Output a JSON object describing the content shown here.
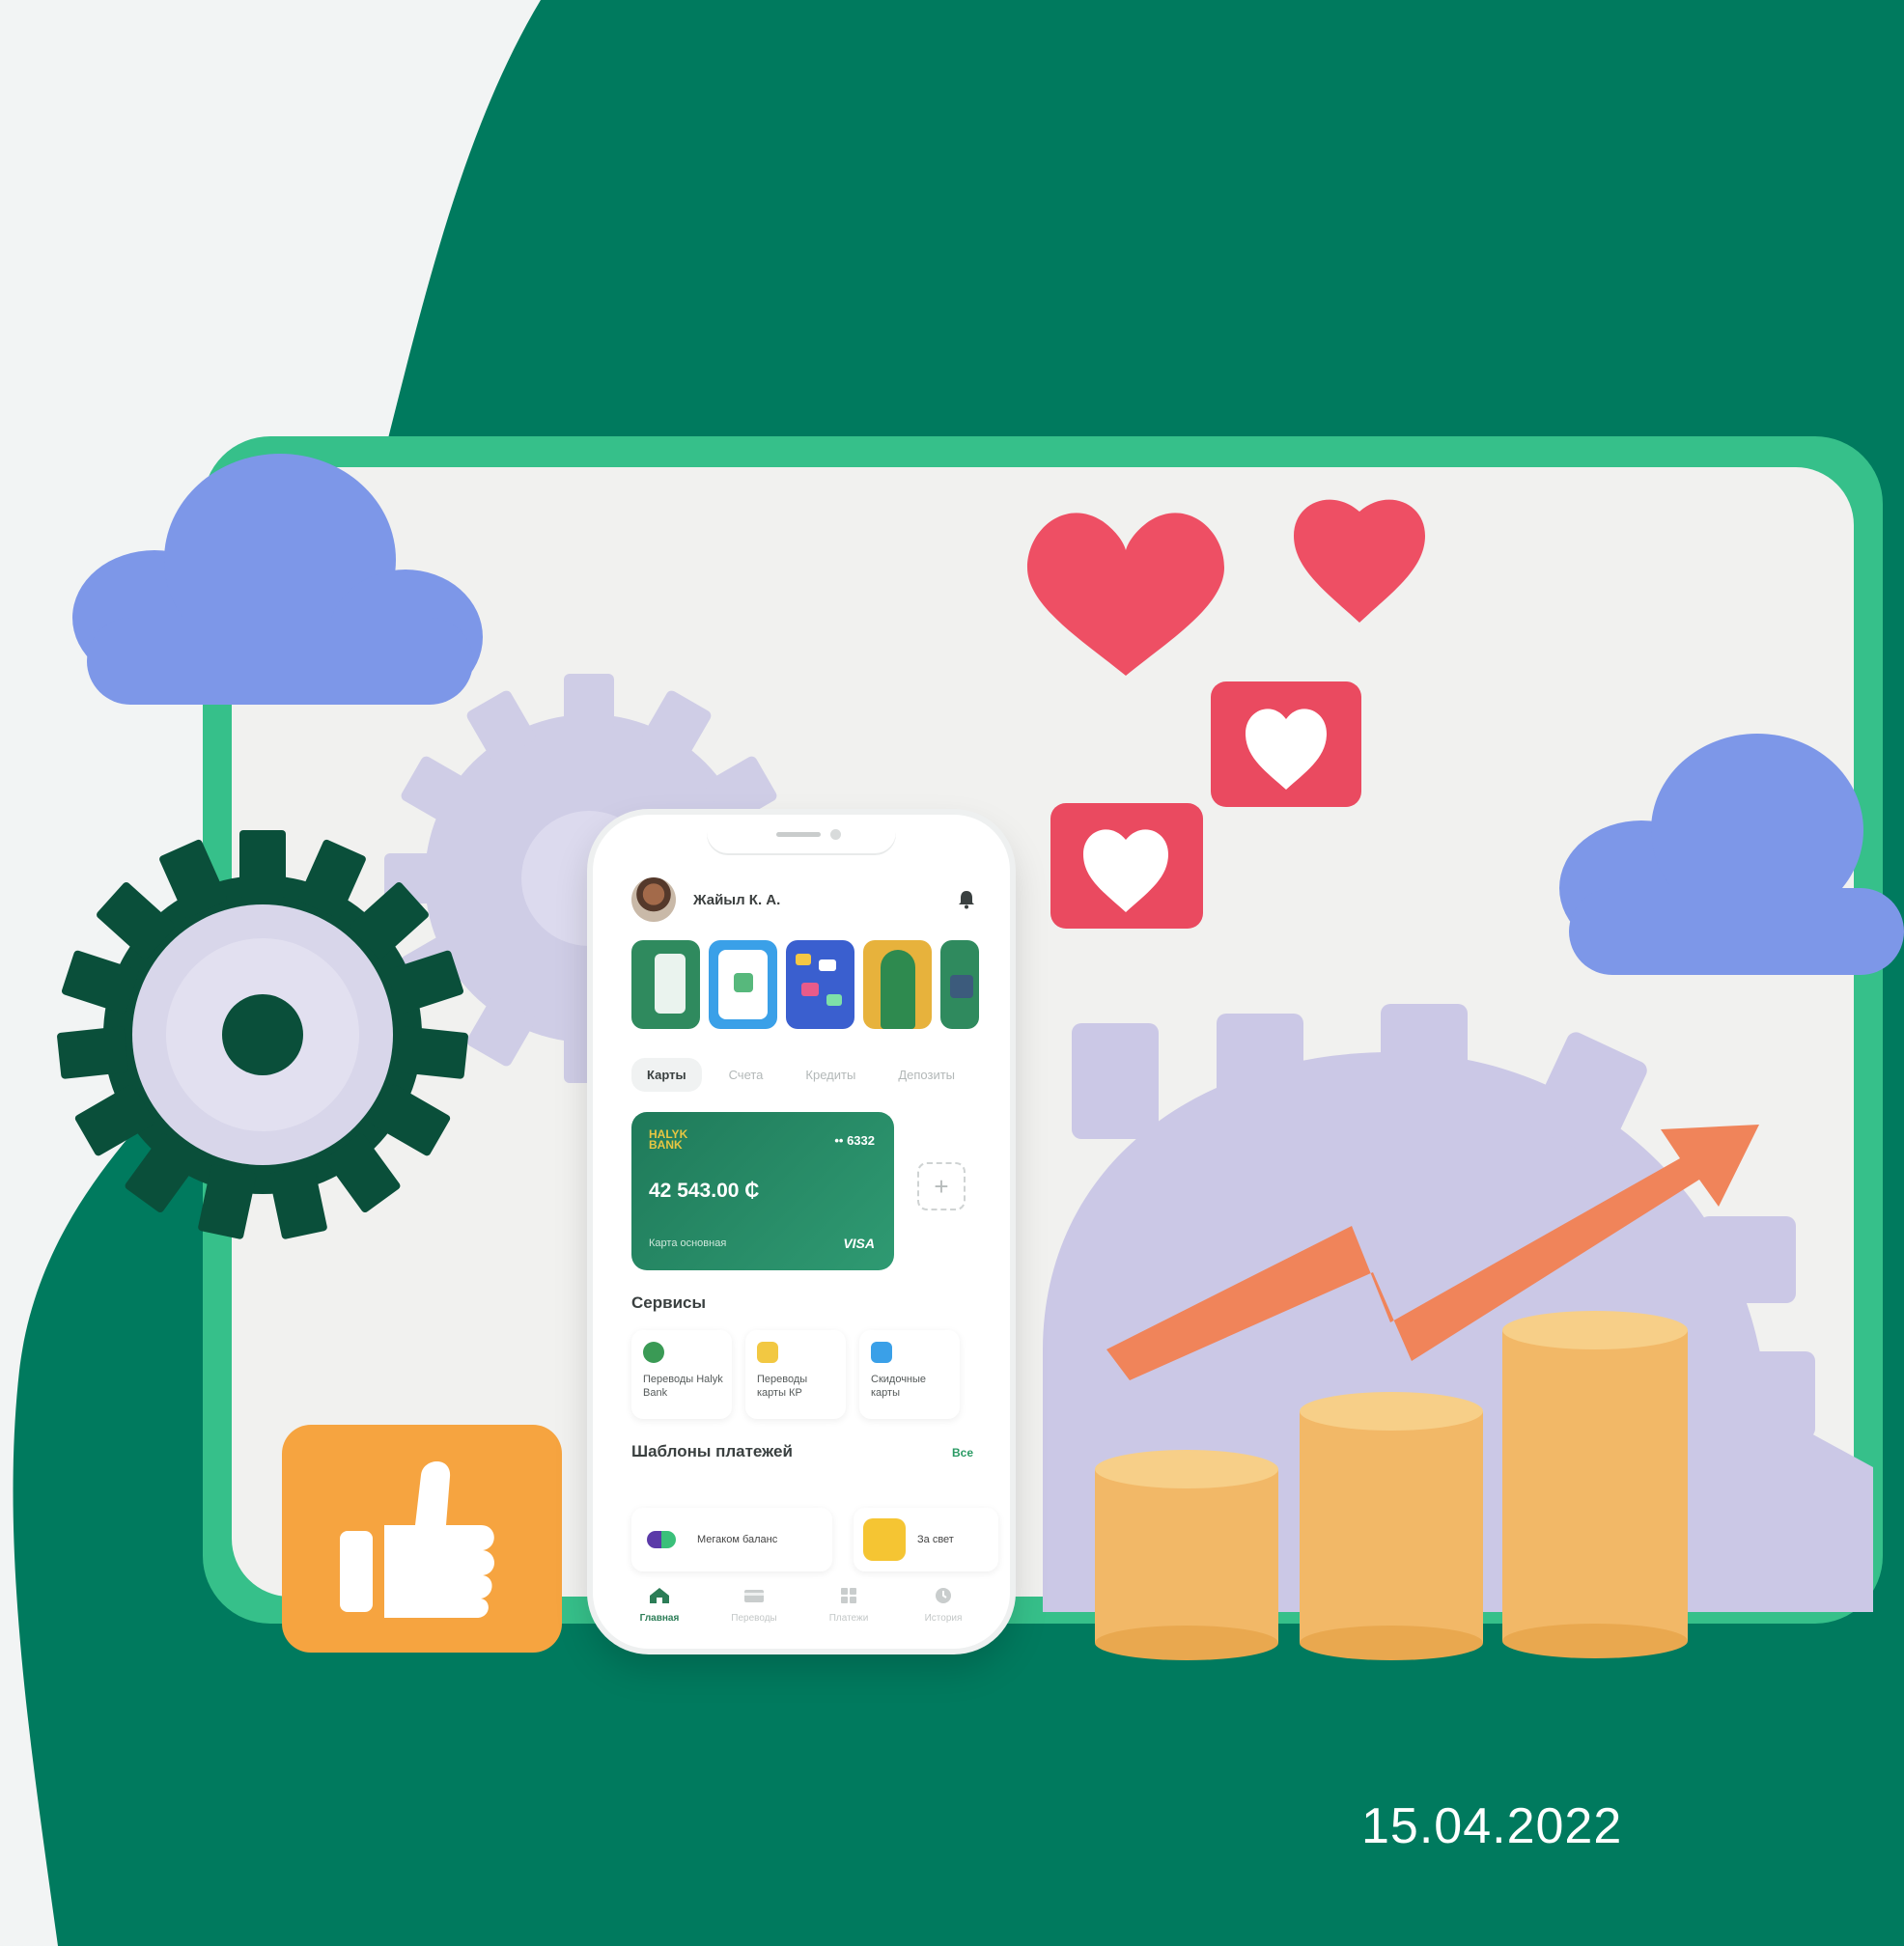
{
  "colors": {
    "brand_green": "#007a5e",
    "panel_green": "#36c08a",
    "accent_orange": "#f6a440",
    "heart_red": "#ee4f64"
  },
  "user": {
    "name": "Жайыл К. А."
  },
  "tabs": [
    "Карты",
    "Счета",
    "Кредиты",
    "Депозиты"
  ],
  "card": {
    "brand": "HALYK BANK",
    "number": "•• 6332",
    "balance": "42 543.00 ₵",
    "name": "Карта основная",
    "network": "VISA"
  },
  "services": {
    "title": "Сервисы",
    "items": [
      {
        "label": "Переводы Halyk Bank",
        "icon": "clover-icon"
      },
      {
        "label": "Переводы карты КР",
        "icon": "card-transfer-icon"
      },
      {
        "label": "Скидочные карты",
        "icon": "discount-icon"
      }
    ]
  },
  "templates": {
    "title": "Шаблоны платежей",
    "all_label": "Все",
    "items": [
      {
        "label": "Мегаком баланс",
        "icon": "megacom-icon"
      },
      {
        "label": "За свет",
        "icon": "lightbulb-icon"
      }
    ]
  },
  "bottom_nav": [
    {
      "label": "Главная",
      "icon": "home-icon",
      "active": true
    },
    {
      "label": "Переводы",
      "icon": "card-icon",
      "active": false
    },
    {
      "label": "Платежи",
      "icon": "grid-icon",
      "active": false
    },
    {
      "label": "История",
      "icon": "clock-icon",
      "active": false
    }
  ],
  "date": "15.04.2022"
}
